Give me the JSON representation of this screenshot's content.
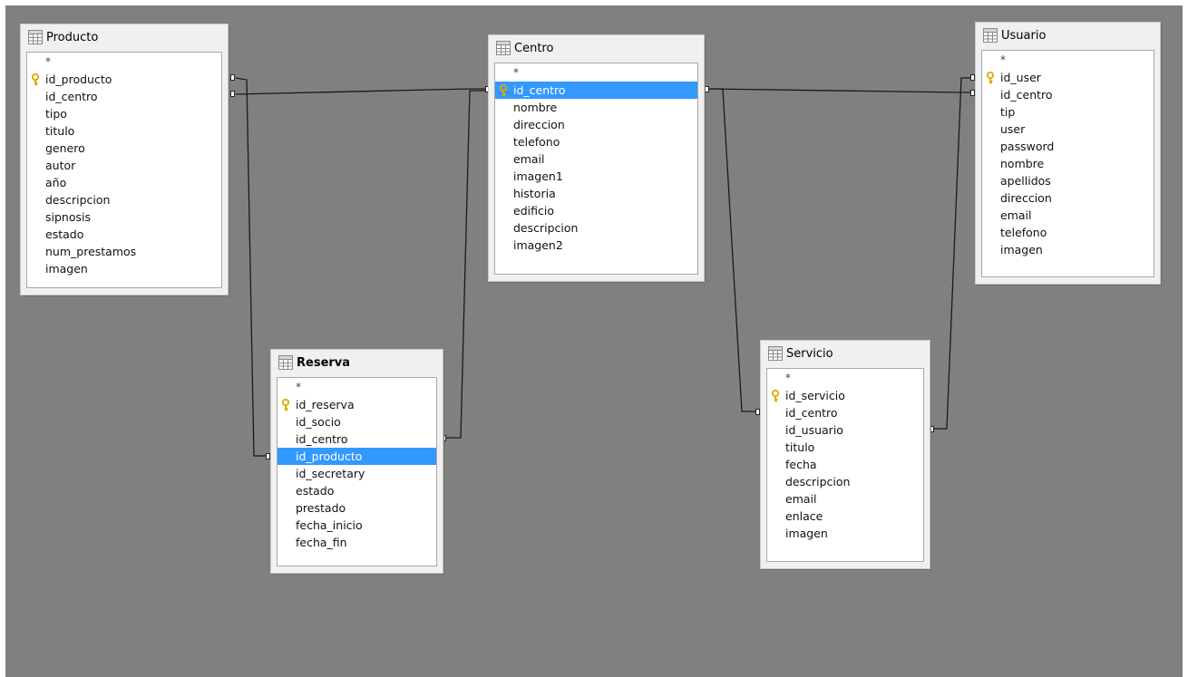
{
  "tables": {
    "producto": {
      "name": "Producto",
      "fields": [
        "*",
        "id_producto",
        "id_centro",
        "tipo",
        "titulo",
        "genero",
        "autor",
        "año",
        "descripcion",
        "sipnosis",
        "estado",
        "num_prestamos",
        "imagen"
      ],
      "key_field": "id_producto",
      "selected_field": null
    },
    "centro": {
      "name": "Centro",
      "fields": [
        "*",
        "id_centro",
        "nombre",
        "direccion",
        "telefono",
        "email",
        "imagen1",
        "historia",
        "edificio",
        "descripcion",
        "imagen2"
      ],
      "key_field": "id_centro",
      "selected_field": "id_centro"
    },
    "usuario": {
      "name": "Usuario",
      "fields": [
        "*",
        "id_user",
        "id_centro",
        "tip",
        "user",
        "password",
        "nombre",
        "apellidos",
        "direccion",
        "email",
        "telefono",
        "imagen"
      ],
      "key_field": "id_user",
      "selected_field": null
    },
    "reserva": {
      "name": "Reserva",
      "fields": [
        "*",
        "id_reserva",
        "id_socio",
        "id_centro",
        "id_producto",
        "id_secretary",
        "estado",
        "prestado",
        "fecha_inicio",
        "fecha_fin"
      ],
      "key_field": "id_reserva",
      "selected_field": "id_producto"
    },
    "servicio": {
      "name": "Servicio",
      "fields": [
        "*",
        "id_servicio",
        "id_centro",
        "id_usuario",
        "titulo",
        "fecha",
        "descripcion",
        "email",
        "enlace",
        "imagen"
      ],
      "key_field": "id_servicio",
      "selected_field": null
    }
  },
  "relations": [
    {
      "from": "producto.id_centro",
      "to": "centro.id_centro"
    },
    {
      "from": "producto.id_producto",
      "to": "reserva.id_producto"
    },
    {
      "from": "reserva.id_centro",
      "to": "centro.id_centro"
    },
    {
      "from": "centro.id_centro",
      "to": "usuario.id_centro"
    },
    {
      "from": "centro.id_centro",
      "to": "servicio.id_centro"
    },
    {
      "from": "servicio.id_usuario",
      "to": "usuario.id_user"
    }
  ],
  "colors": {
    "canvas": "#808080",
    "selection": "#3399ff",
    "key_icon": "#e0a800"
  }
}
